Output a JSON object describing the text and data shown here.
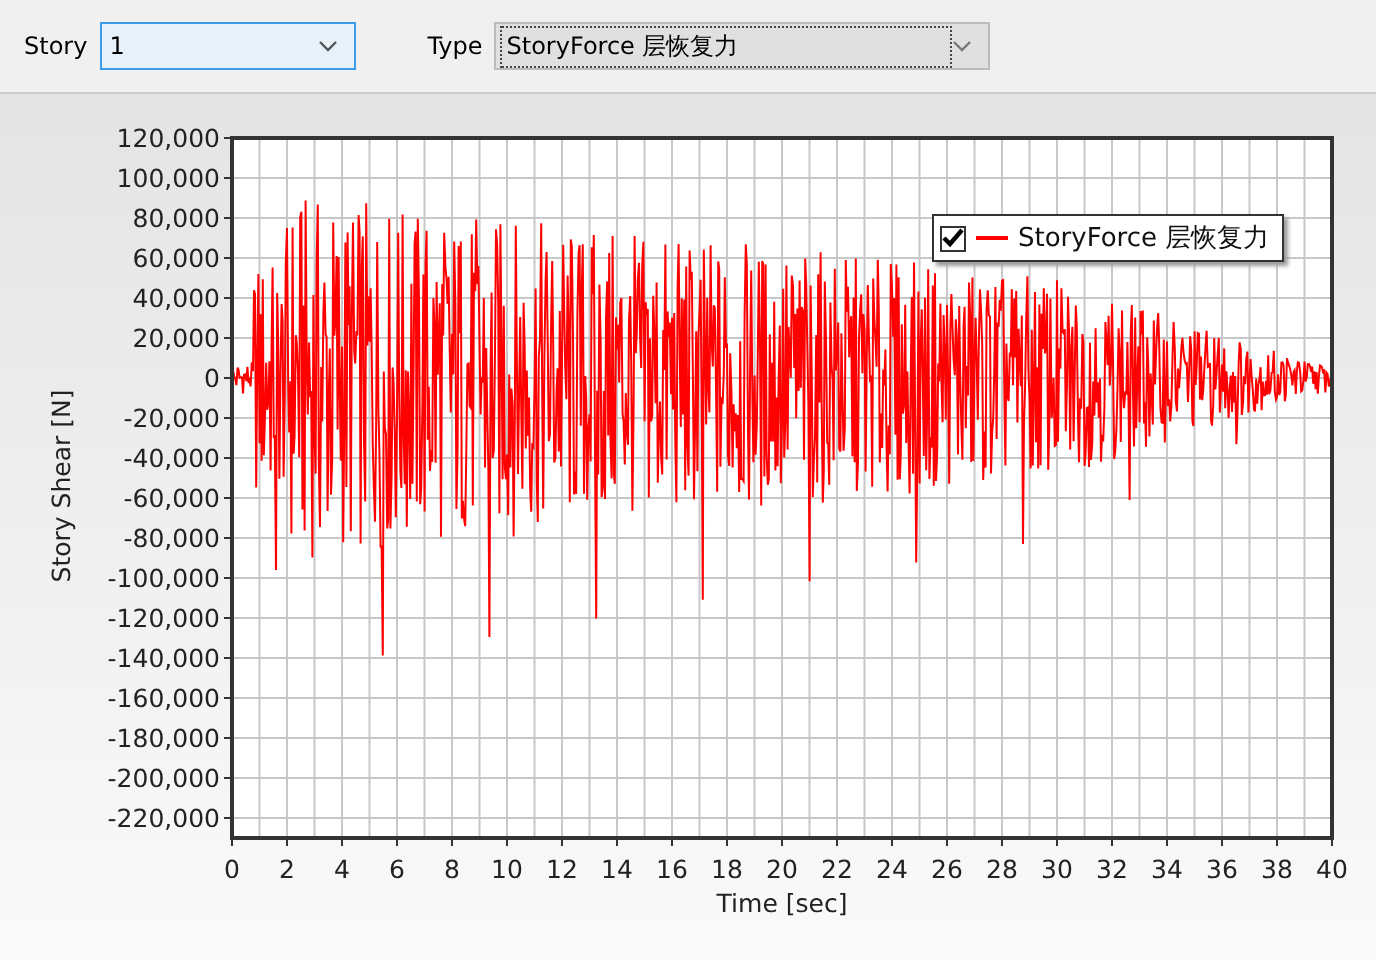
{
  "toolbar": {
    "story": {
      "label": "Story",
      "value": "1"
    },
    "type": {
      "label": "Type",
      "value": "StoryForce 层恢复力"
    }
  },
  "chart": {
    "y_label": "Story Shear [N]",
    "x_label": "Time [sec]",
    "y_ticks": [
      "120,000",
      "100,000",
      "80,000",
      "60,000",
      "40,000",
      "20,000",
      "0",
      "-20,000",
      "-40,000",
      "-60,000",
      "-80,000",
      "-100,000",
      "-120,000",
      "-140,000",
      "-160,000",
      "-180,000",
      "-200,000",
      "-220,000"
    ],
    "x_ticks": [
      "0",
      "2",
      "4",
      "6",
      "8",
      "10",
      "12",
      "14",
      "16",
      "18",
      "20",
      "22",
      "24",
      "26",
      "28",
      "30",
      "32",
      "34",
      "36",
      "38",
      "40"
    ],
    "legend": {
      "checked": true,
      "label": "StoryForce 层恢复力"
    }
  }
}
